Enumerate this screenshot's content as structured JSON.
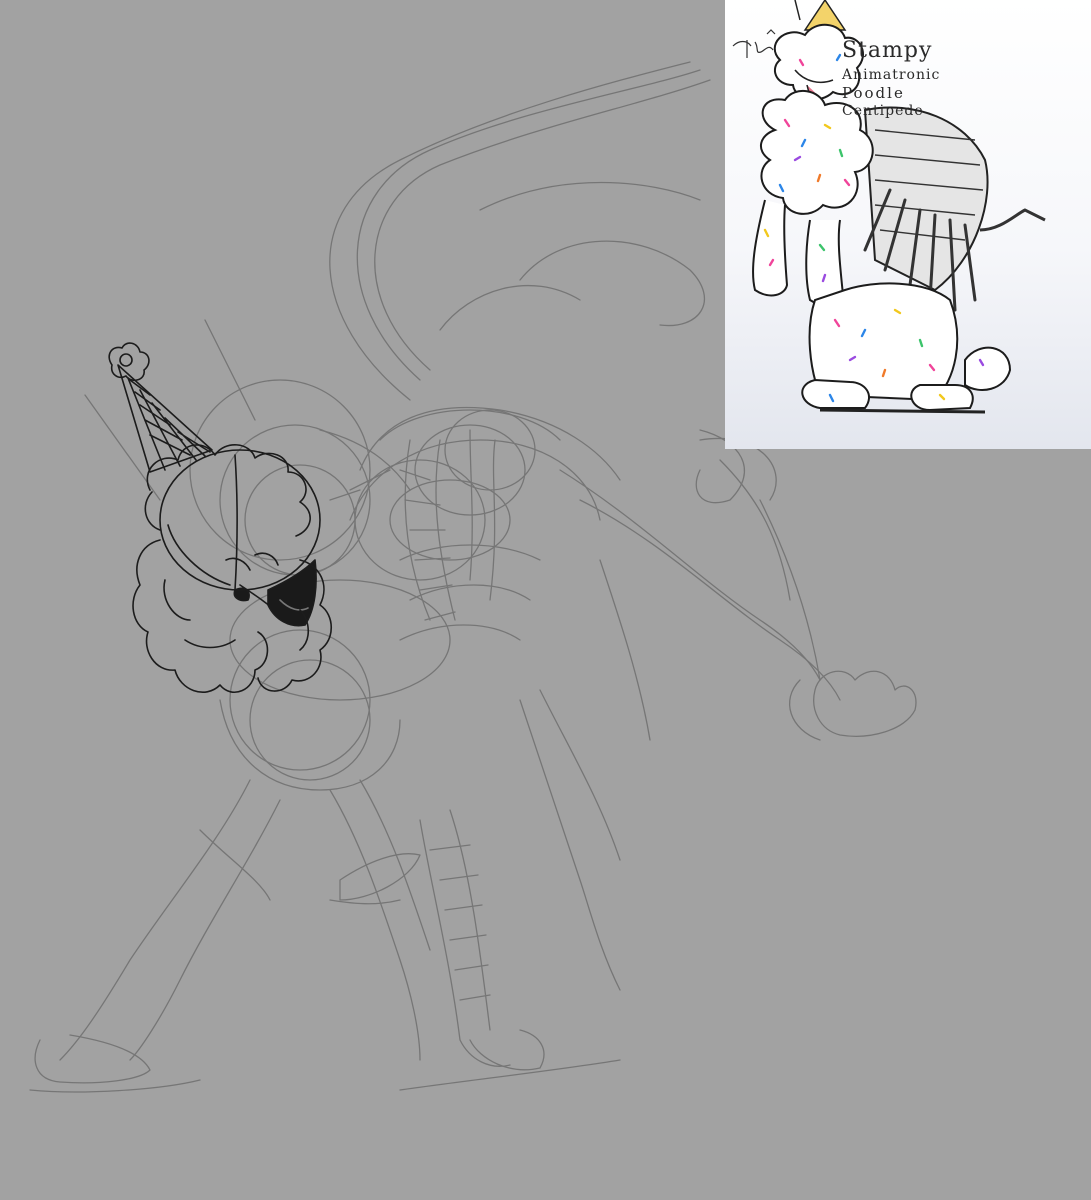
{
  "artwork": {
    "background_color": "#a2a2a2",
    "sketch_line_color": "#6e6e6e",
    "ink_line_color": "#1a1a1a"
  },
  "reference": {
    "title": "Stampy",
    "line1": "Animatronic",
    "line2": "Poodle",
    "line3": "Centipede",
    "sprinkle_colors": [
      "#f0449a",
      "#2c86e8",
      "#f2c81d",
      "#3cc46b",
      "#9a4ae0",
      "#f07a2a"
    ]
  }
}
